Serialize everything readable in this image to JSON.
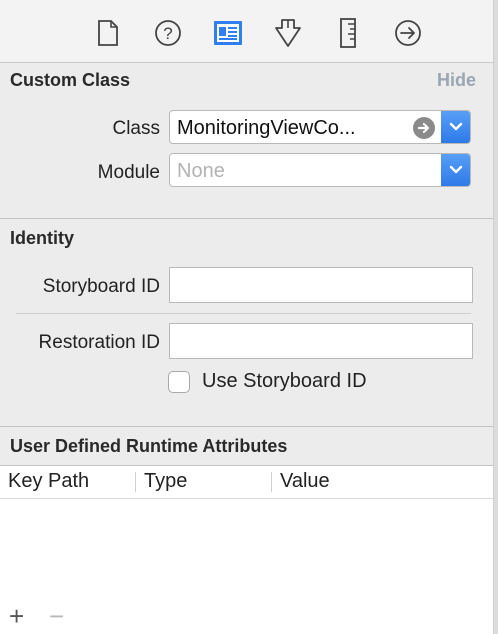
{
  "toolbar": {
    "icons": [
      {
        "name": "file-inspector-icon",
        "selected": false
      },
      {
        "name": "quick-help-icon",
        "selected": false
      },
      {
        "name": "identity-inspector-icon",
        "selected": true
      },
      {
        "name": "attributes-inspector-icon",
        "selected": false
      },
      {
        "name": "size-inspector-icon",
        "selected": false
      },
      {
        "name": "connections-inspector-icon",
        "selected": false
      }
    ],
    "accent_color": "#2f7ff0",
    "icon_color": "#444444"
  },
  "custom_class": {
    "title": "Custom Class",
    "hide_label": "Hide",
    "class_label": "Class",
    "class_value": "MonitoringViewCo...",
    "module_label": "Module",
    "module_placeholder": "None"
  },
  "identity": {
    "title": "Identity",
    "storyboard_id_label": "Storyboard ID",
    "storyboard_id_value": "",
    "restoration_id_label": "Restoration ID",
    "restoration_id_value": "",
    "use_storyboard_id_label": "Use Storyboard ID",
    "use_storyboard_id_checked": false
  },
  "runtime_attributes": {
    "title": "User Defined Runtime Attributes",
    "columns": [
      "Key Path",
      "Type",
      "Value"
    ],
    "rows": [],
    "add_label": "+",
    "remove_label": "−"
  }
}
